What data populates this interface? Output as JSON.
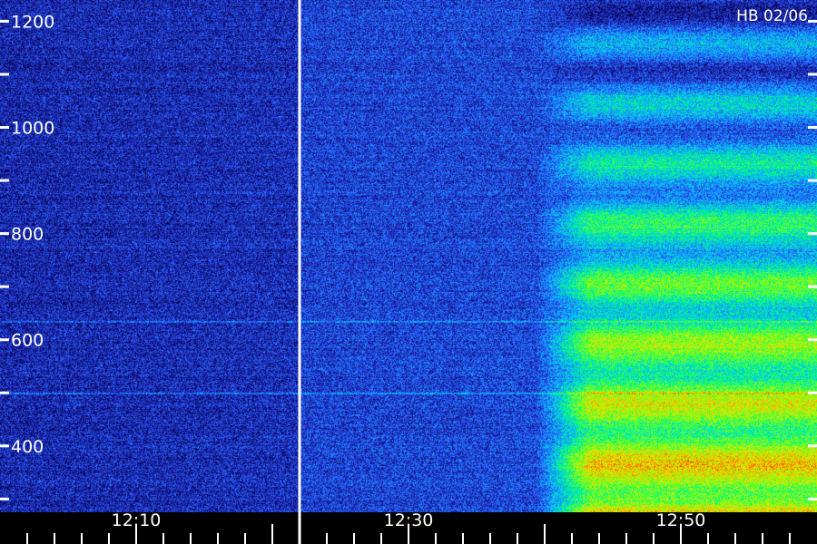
{
  "chart_data": {
    "type": "heatmap",
    "title": "",
    "annotation": "HB 02/06",
    "xlabel": "",
    "ylabel": "",
    "x_tick_labels": [
      "12:10",
      "12:30",
      "12:50"
    ],
    "y_tick_labels": [
      "400",
      "600",
      "800",
      "1000",
      "1200"
    ],
    "y_tick_values": [
      400,
      600,
      800,
      1000,
      1200
    ],
    "y_minor_tick_values": [
      300,
      500,
      700,
      900,
      1100
    ],
    "ylim": [
      275,
      1240
    ],
    "xlim_minutes": [
      0,
      60
    ],
    "x_tick_minutes": [
      10,
      30,
      50
    ],
    "marker_time_minutes": 22,
    "colormap": [
      "#000030",
      "#1a1aa0",
      "#2a60ff",
      "#00c8ff",
      "#00ff70",
      "#a0ff00",
      "#ffd000",
      "#ff3000"
    ],
    "grid": false,
    "legend": "none",
    "features": [
      {
        "name": "broadband event",
        "start_minute": 42,
        "end_minute": 60
      },
      {
        "name": "interference line",
        "value": 500
      },
      {
        "name": "interference line",
        "value": 635
      }
    ]
  },
  "colors": {
    "background": "#000000",
    "axis": "#ffffff",
    "text": "#ffffff",
    "marker": "#ffffff"
  }
}
